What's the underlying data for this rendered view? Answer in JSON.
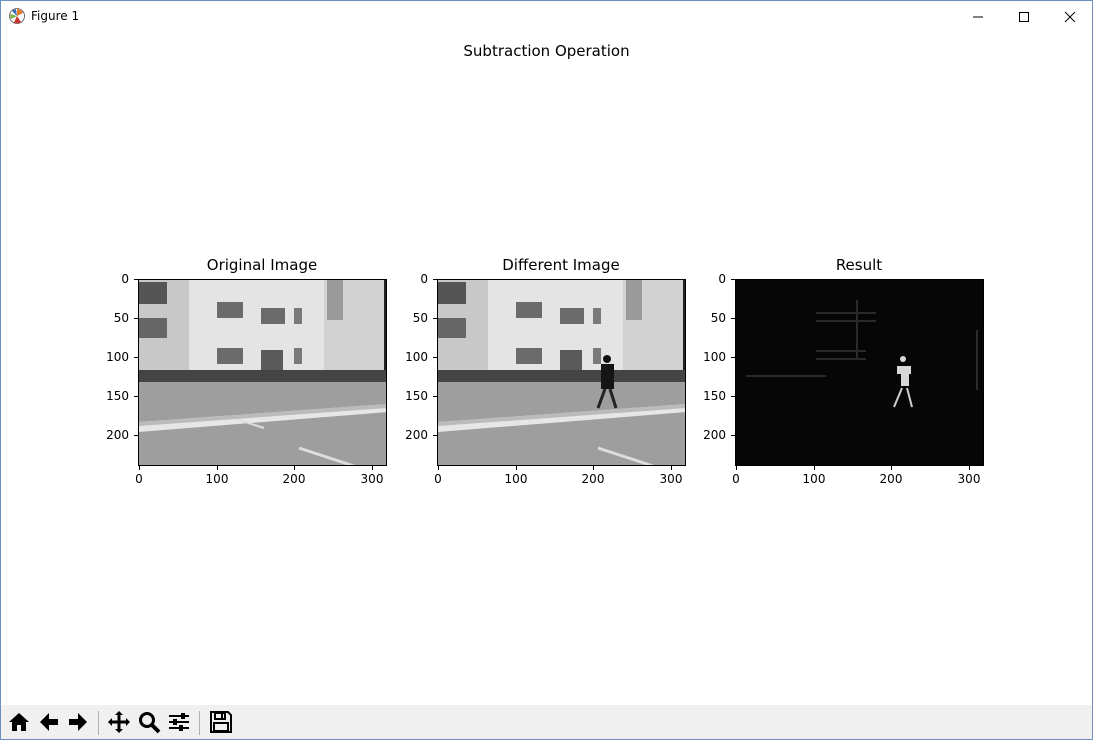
{
  "window": {
    "title": "Figure 1"
  },
  "figure": {
    "suptitle": "Subtraction Operation",
    "subplots": [
      {
        "title": "Original Image",
        "yticks": [
          "0",
          "50",
          "100",
          "150",
          "200"
        ],
        "xticks": [
          "0",
          "100",
          "200",
          "300"
        ]
      },
      {
        "title": "Different Image",
        "yticks": [
          "0",
          "50",
          "100",
          "150",
          "200"
        ],
        "xticks": [
          "0",
          "100",
          "200",
          "300"
        ]
      },
      {
        "title": "Result",
        "yticks": [
          "0",
          "50",
          "100",
          "150",
          "200"
        ],
        "xticks": [
          "0",
          "100",
          "200",
          "300"
        ]
      }
    ]
  },
  "toolbar": {
    "buttons": [
      "home-icon",
      "back-arrow-icon",
      "forward-arrow-icon",
      "pan-icon",
      "zoom-icon",
      "configure-subplots-icon",
      "save-icon"
    ]
  }
}
